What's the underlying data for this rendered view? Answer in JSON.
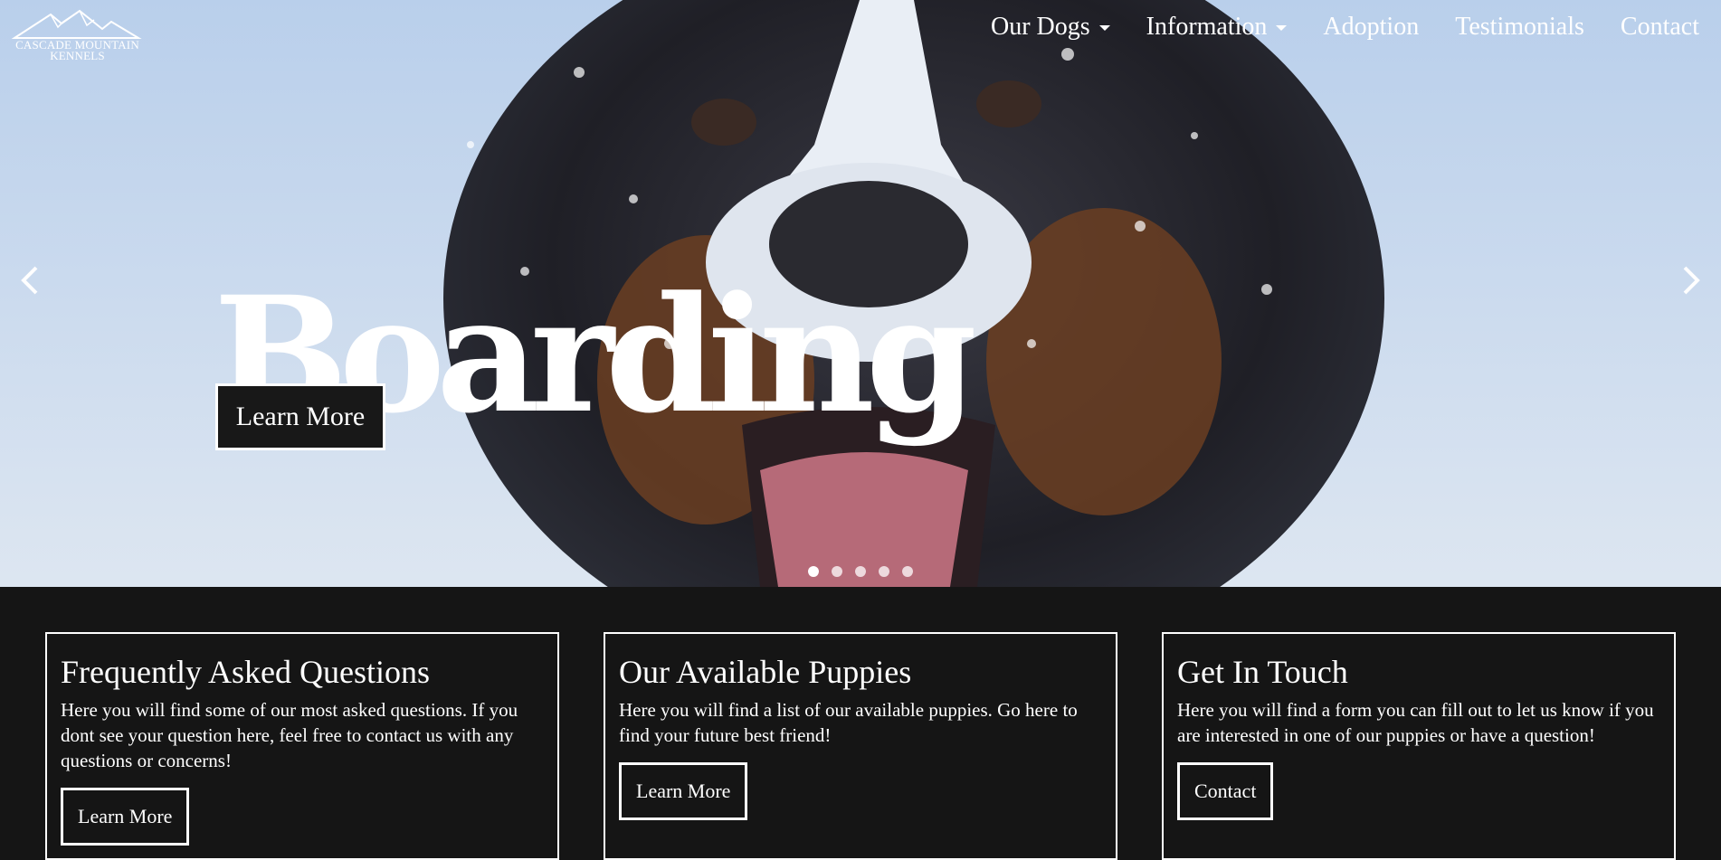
{
  "brand": {
    "logo_line1": "CASCADE MOUNTAIN",
    "logo_line2": "KENNELS"
  },
  "nav": {
    "items": [
      {
        "label": "Our Dogs",
        "dropdown": true
      },
      {
        "label": "Information",
        "dropdown": true
      },
      {
        "label": "Adoption",
        "dropdown": false
      },
      {
        "label": "Testimonials",
        "dropdown": false
      },
      {
        "label": "Contact",
        "dropdown": false
      }
    ]
  },
  "hero": {
    "title": "Boarding",
    "button_label": "Learn More",
    "slide_count": 5,
    "active_slide": 1,
    "prev_icon": "chevron-left-icon",
    "next_icon": "chevron-right-icon"
  },
  "cards": [
    {
      "title": "Frequently Asked Questions",
      "text": "Here you will find some of our most asked questions. If you dont see your question here, feel free to contact us with any questions or concerns!",
      "button": "Learn More"
    },
    {
      "title": "Our Available Puppies",
      "text": "Here you will find a list of our available puppies. Go here to find your future best friend!",
      "button": "Learn More"
    },
    {
      "title": "Get In Touch",
      "text": "Here you will find a form you can fill out to let us know if you are interested in one of our puppies or have a question!",
      "button": "Contact"
    }
  ],
  "colors": {
    "background": "#151515",
    "snow": "#c8d8ec",
    "button_bg": "#181818",
    "text": "#ffffff"
  }
}
